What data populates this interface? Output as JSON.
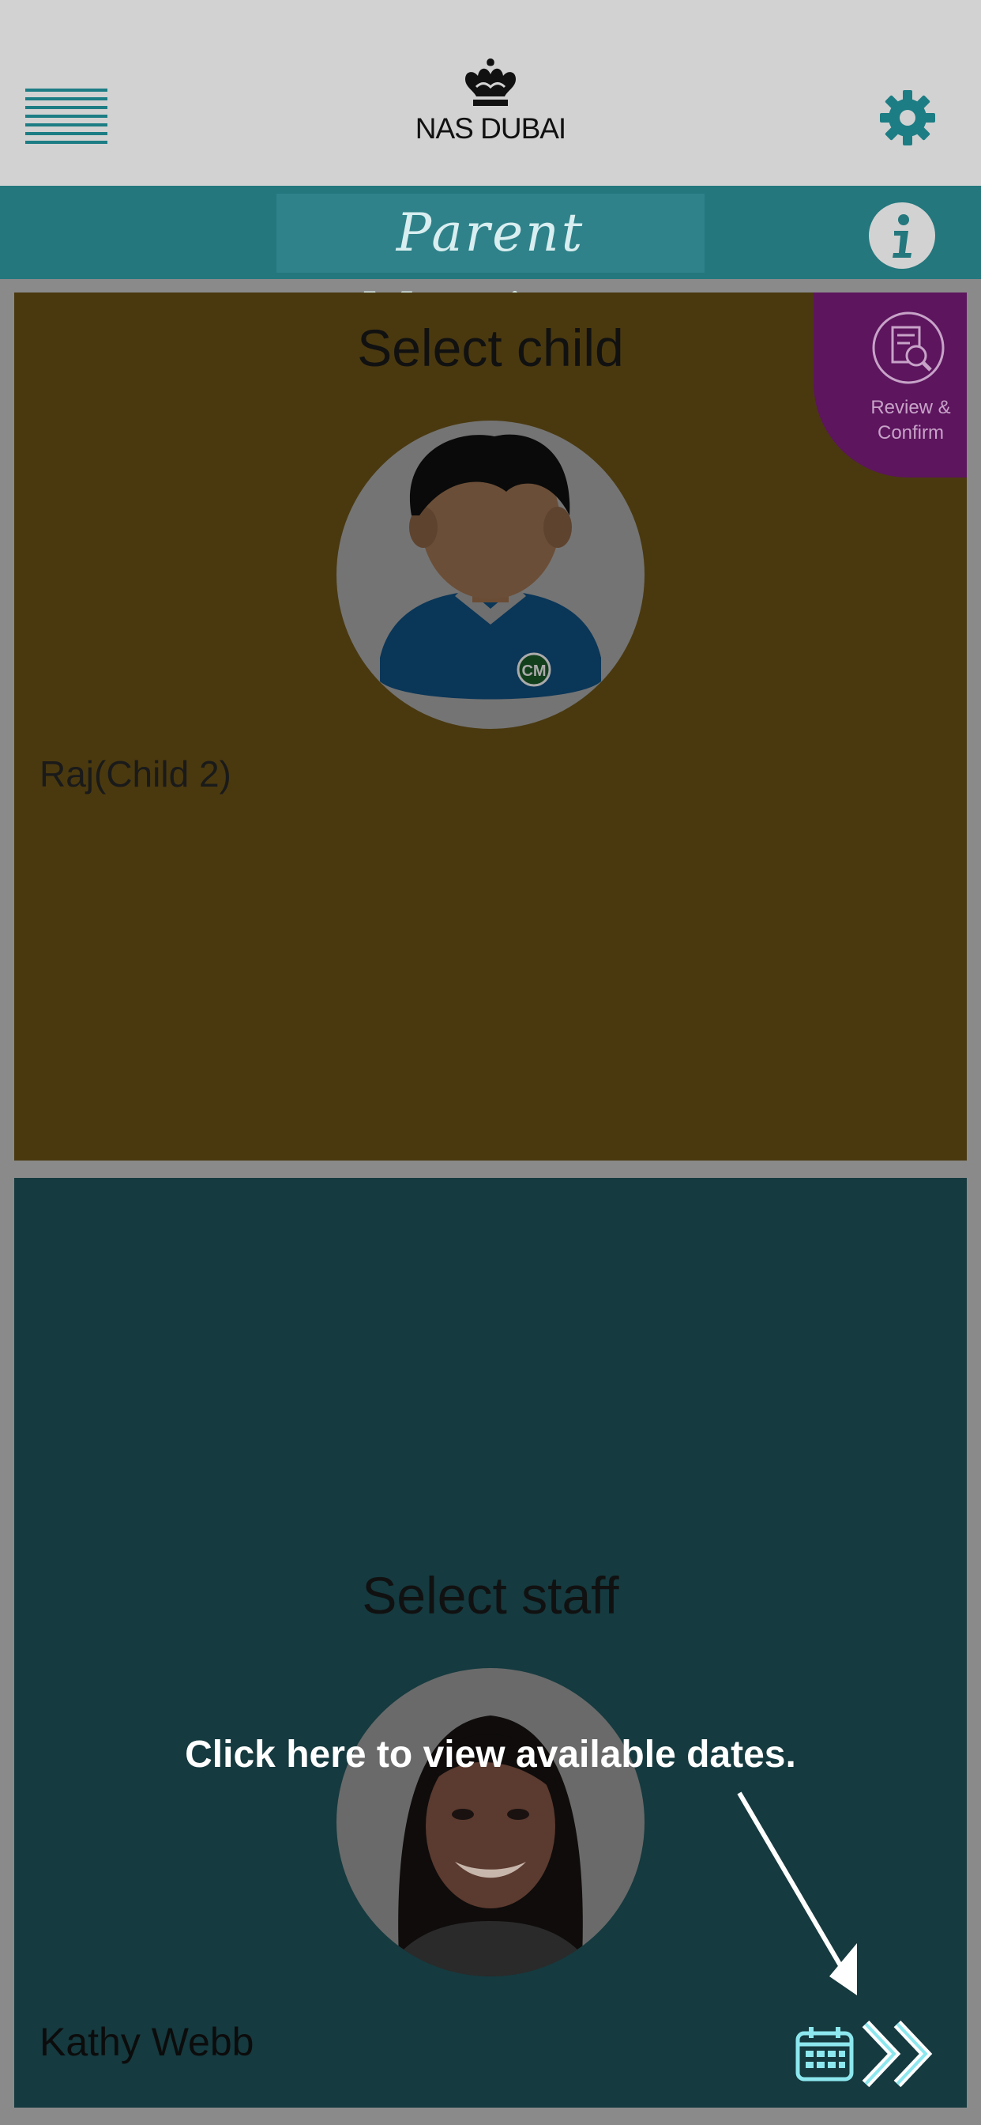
{
  "header": {
    "logo_text": "NAS DUBAI",
    "menu_icon": "hamburger-menu-icon",
    "settings_icon": "gear-icon"
  },
  "titlebar": {
    "title": "Parent Meetings",
    "info_icon": "info-icon"
  },
  "child_panel": {
    "heading": "Select child",
    "child_name": "Raj(Child 2)",
    "review_badge": "Review & Confirm"
  },
  "staff_panel": {
    "heading": "Select staff",
    "staff_name": "Kathy Webb",
    "hint": "Click here to view available dates."
  },
  "colors": {
    "overlay_header": "#d2d2d2",
    "accent_teal": "#23777d",
    "child_panel": "#4a390f",
    "staff_panel": "#153a3f",
    "review_badge": "#5d155e",
    "highlight_icon": "#8ce7ee"
  }
}
